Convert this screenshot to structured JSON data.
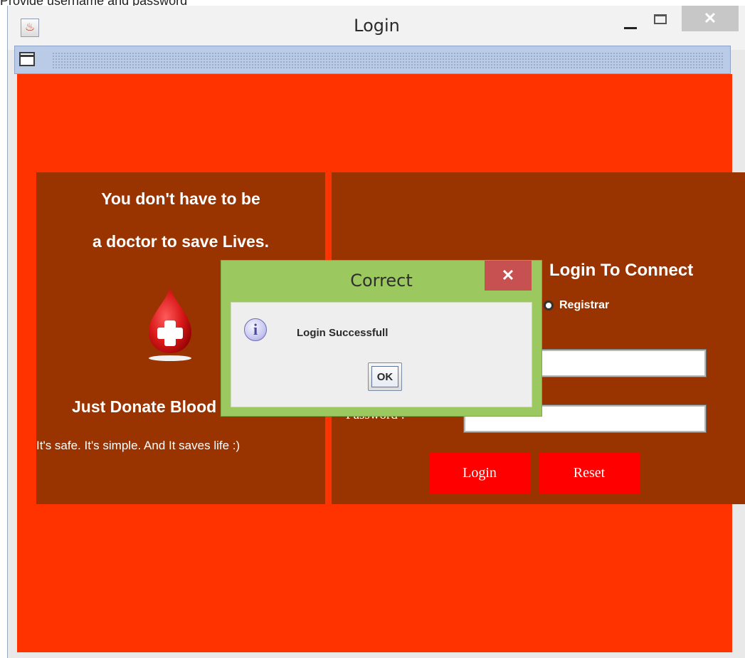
{
  "page": {
    "caption": "Provide username and password"
  },
  "window": {
    "title": "Login",
    "close_glyph": "✕",
    "icons": {
      "app": "java-cup-icon",
      "minimize": "minimize-icon",
      "maximize": "maximize-icon",
      "close": "close-icon",
      "internal_frame": "window-icon"
    }
  },
  "left_panel": {
    "line1": "You don't have to be",
    "line2": "a doctor to save Lives.",
    "donate": "Just Donate Blood",
    "tagline": "It's safe. It's simple. And It saves life :)",
    "icon": "blood-drop-icon"
  },
  "right_panel": {
    "heading": "Login To Connect",
    "radio_label": "Registrar",
    "username_value": "",
    "password_label": "Password :",
    "password_value": "••••••••••",
    "login_button": "Login",
    "reset_button": "Reset"
  },
  "dialog": {
    "title": "Correct",
    "close_glyph": "✕",
    "info_glyph": "i",
    "message": "Login Successfull",
    "ok_button": "OK",
    "icon": "info-icon"
  },
  "colors": {
    "background_red": "#ff3300",
    "panel_brown": "#993300",
    "button_red": "#ff0000",
    "dialog_green": "#9bc85f",
    "dialog_close": "#c75050"
  }
}
